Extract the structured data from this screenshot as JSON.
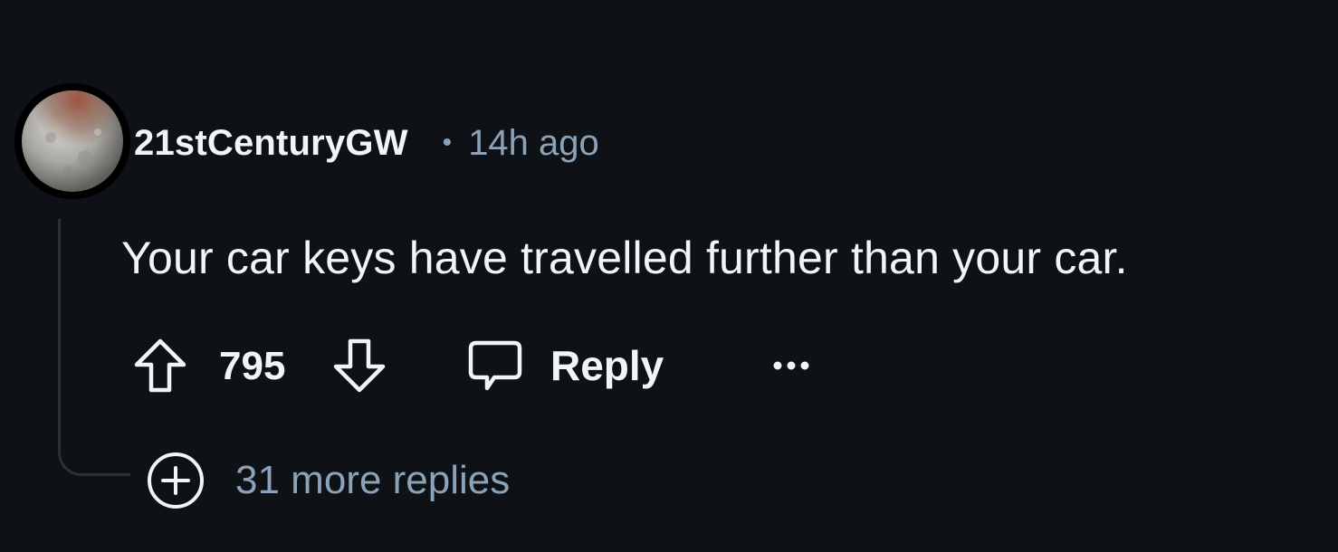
{
  "comment": {
    "author": "21stCenturyGW",
    "separator": "•",
    "time": "14h ago",
    "body": "Your car keys have travelled further than your car.",
    "score": "795",
    "reply_label": "Reply",
    "more_replies": "31 more replies"
  },
  "icons": {
    "avatar": "planet-avatar",
    "upvote": "arrow-up-icon",
    "downvote": "arrow-down-icon",
    "reply": "speech-bubble-icon",
    "more": "ellipsis-icon",
    "expand": "plus-circle-icon"
  },
  "colors": {
    "background": "#0e1115",
    "text": "#f2f4f5",
    "muted": "#8ba2b8",
    "thread_line": "#2a3036"
  }
}
